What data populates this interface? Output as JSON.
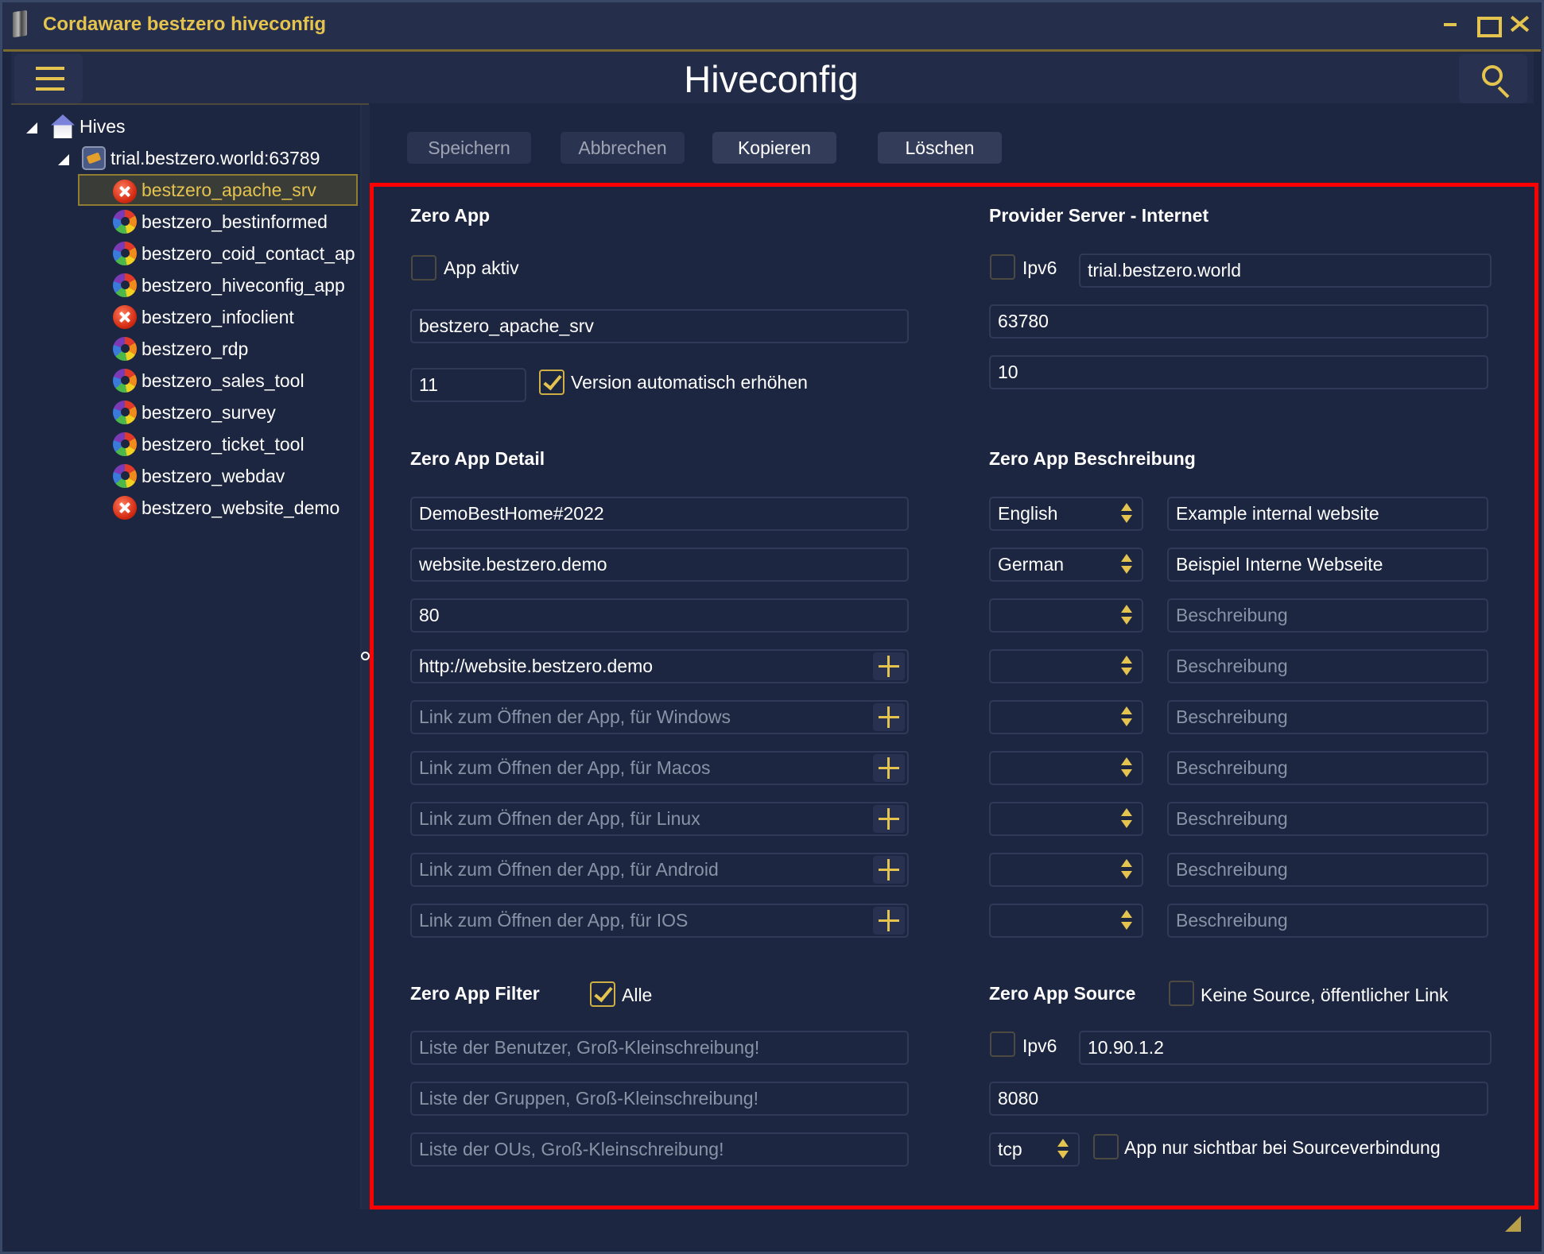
{
  "window": {
    "title": "Cordaware bestzero hiveconfig",
    "controls": {
      "minimize": "minimize",
      "maximize": "maximize",
      "close": "close"
    }
  },
  "header": {
    "page_title": "Hiveconfig",
    "menu_icon": "hamburger-menu-icon",
    "search_icon": "search-icon"
  },
  "tree": {
    "root": {
      "label": "Hives",
      "icon": "house-icon",
      "expanded": true
    },
    "server": {
      "label": "trial.bestzero.world:63789",
      "icon": "server-icon",
      "expanded": true
    },
    "apps": [
      {
        "label": "bestzero_apache_srv",
        "status": "error",
        "selected": true
      },
      {
        "label": "bestzero_bestinformed",
        "status": "ok",
        "selected": false
      },
      {
        "label": "bestzero_coid_contact_ap",
        "status": "ok",
        "selected": false
      },
      {
        "label": "bestzero_hiveconfig_app",
        "status": "ok",
        "selected": false
      },
      {
        "label": "bestzero_infoclient",
        "status": "error",
        "selected": false
      },
      {
        "label": "bestzero_rdp",
        "status": "ok",
        "selected": false
      },
      {
        "label": "bestzero_sales_tool",
        "status": "ok",
        "selected": false
      },
      {
        "label": "bestzero_survey",
        "status": "ok",
        "selected": false
      },
      {
        "label": "bestzero_ticket_tool",
        "status": "ok",
        "selected": false
      },
      {
        "label": "bestzero_webdav",
        "status": "ok",
        "selected": false
      },
      {
        "label": "bestzero_website_demo",
        "status": "error",
        "selected": false
      }
    ]
  },
  "toolbar": {
    "save": {
      "label": "Speichern",
      "enabled": false
    },
    "cancel": {
      "label": "Abbrechen",
      "enabled": false
    },
    "copy": {
      "label": "Kopieren",
      "enabled": true
    },
    "delete": {
      "label": "Löschen",
      "enabled": true
    }
  },
  "zero_app": {
    "title": "Zero App",
    "app_active": {
      "label": "App aktiv",
      "checked": false
    },
    "name": "bestzero_apache_srv",
    "version": "11",
    "auto_version": {
      "label": "Version automatisch erhöhen",
      "checked": true
    }
  },
  "provider_server": {
    "title": "Provider Server - Internet",
    "ipv6": {
      "label": "Ipv6",
      "checked": false
    },
    "host": "trial.bestzero.world",
    "port": "63780",
    "value3": "10"
  },
  "zero_app_detail": {
    "title": "Zero App Detail",
    "password": "DemoBestHome#2022",
    "host": "website.bestzero.demo",
    "port": "80",
    "links": [
      {
        "value": "http://website.bestzero.demo",
        "placeholder": "",
        "add_icon": "plus-icon"
      },
      {
        "value": "",
        "placeholder": "Link zum Öffnen der App, für Windows",
        "add_icon": "plus-icon"
      },
      {
        "value": "",
        "placeholder": "Link zum Öffnen der App, für Macos",
        "add_icon": "plus-icon"
      },
      {
        "value": "",
        "placeholder": "Link zum Öffnen der App, für Linux",
        "add_icon": "plus-icon"
      },
      {
        "value": "",
        "placeholder": "Link zum Öffnen der App, für Android",
        "add_icon": "plus-icon"
      },
      {
        "value": "",
        "placeholder": "Link zum Öffnen der App, für IOS",
        "add_icon": "plus-icon"
      }
    ]
  },
  "zero_app_description": {
    "title": "Zero App Beschreibung",
    "rows": [
      {
        "language": "English",
        "text": "Example internal website",
        "placeholder": "Beschreibung"
      },
      {
        "language": "German",
        "text": "Beispiel Interne Webseite",
        "placeholder": "Beschreibung"
      },
      {
        "language": "",
        "text": "",
        "placeholder": "Beschreibung"
      },
      {
        "language": "",
        "text": "",
        "placeholder": "Beschreibung"
      },
      {
        "language": "",
        "text": "",
        "placeholder": "Beschreibung"
      },
      {
        "language": "",
        "text": "",
        "placeholder": "Beschreibung"
      },
      {
        "language": "",
        "text": "",
        "placeholder": "Beschreibung"
      },
      {
        "language": "",
        "text": "",
        "placeholder": "Beschreibung"
      },
      {
        "language": "",
        "text": "",
        "placeholder": "Beschreibung"
      }
    ]
  },
  "zero_app_filter": {
    "title": "Zero App Filter",
    "all": {
      "label": "Alle",
      "checked": true
    },
    "users_placeholder": "Liste der Benutzer, Groß-Kleinschreibung!",
    "groups_placeholder": "Liste der Gruppen, Groß-Kleinschreibung!",
    "ous_placeholder": "Liste der OUs, Groß-Kleinschreibung!"
  },
  "zero_app_source": {
    "title": "Zero App Source",
    "no_source": {
      "label": "Keine Source, öffentlicher Link",
      "checked": false
    },
    "ipv6": {
      "label": "Ipv6",
      "checked": false
    },
    "host": "10.90.1.2",
    "port": "8080",
    "protocol": "tcp",
    "visible_only_source": {
      "label": "App nur sichtbar bei Sourceverbindung",
      "checked": false
    }
  },
  "colors": {
    "accent": "#e4c34e",
    "background": "#1c2640",
    "highlight_border": "#ff0000",
    "error": "#d22a12"
  }
}
